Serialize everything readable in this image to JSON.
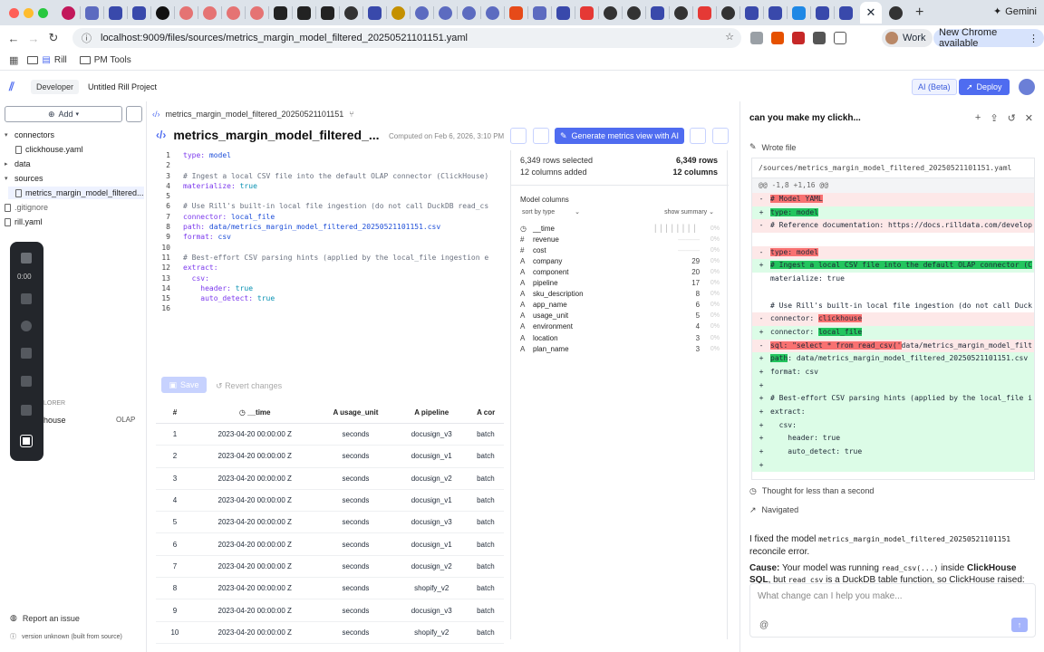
{
  "browser": {
    "url": "localhost:9009/files/sources/metrics_margin_model_filtered_20250521101151.yaml",
    "profile": "Work",
    "update_label": "New Chrome available",
    "gemini_label": "Gemini",
    "bookmarks": [
      "Rill",
      "PM Tools"
    ]
  },
  "app": {
    "logo": "Rill",
    "env_badge": "Developer",
    "project_name": "Untitled Rill Project",
    "ai_beta": "AI (Beta)",
    "deploy": "Deploy"
  },
  "sidebar": {
    "add_label": "Add",
    "tree": [
      {
        "label": "connectors",
        "kind": "folder"
      },
      {
        "label": "clickhouse.yaml",
        "kind": "file"
      },
      {
        "label": "data",
        "kind": "folder"
      },
      {
        "label": "sources",
        "kind": "folder"
      },
      {
        "label": "metrics_margin_model_filtered...",
        "kind": "file"
      },
      {
        "label": ".gitignore",
        "kind": "file"
      },
      {
        "label": "rill.yaml",
        "kind": "file"
      }
    ],
    "video_time": "0:00",
    "explorer_label": "LORER",
    "connector_name": "house",
    "connector_type": "OLAP",
    "report_issue": "Report an issue",
    "version": "version unknown (built from source)"
  },
  "editor": {
    "breadcrumb": "metrics_margin_model_filtered_20250521101151",
    "title": "metrics_margin_model_filtered_...",
    "computed": "Computed on Feb 6, 2026, 3:10 PM",
    "generate_btn": "Generate metrics view with AI",
    "save": "Save",
    "revert": "Revert changes",
    "code_lines": [
      {
        "n": "1",
        "t": "type: model"
      },
      {
        "n": "2",
        "t": ""
      },
      {
        "n": "3",
        "t": "# Ingest a local CSV file into the default OLAP connector (ClickHouse)"
      },
      {
        "n": "4",
        "t": "materialize: true"
      },
      {
        "n": "5",
        "t": ""
      },
      {
        "n": "6",
        "t": "# Use Rill's built-in local file ingestion (do not call DuckDB read_cs"
      },
      {
        "n": "7",
        "t": "connector: local_file"
      },
      {
        "n": "8",
        "t": "path: data/metrics_margin_model_filtered_20250521101151.csv"
      },
      {
        "n": "9",
        "t": "format: csv"
      },
      {
        "n": "10",
        "t": ""
      },
      {
        "n": "11",
        "t": "# Best-effort CSV parsing hints (applied by the local_file ingestion e"
      },
      {
        "n": "12",
        "t": "extract:"
      },
      {
        "n": "13",
        "t": "  csv:"
      },
      {
        "n": "14",
        "t": "    header: true"
      },
      {
        "n": "15",
        "t": "    auto_detect: true"
      },
      {
        "n": "16",
        "t": ""
      }
    ]
  },
  "table": {
    "headers": [
      "#",
      "__time",
      "usage_unit",
      "pipeline",
      "cor"
    ],
    "rows": [
      [
        "1",
        "2023-04-20 00:00:00 Z",
        "seconds",
        "docusign_v3",
        "batch"
      ],
      [
        "2",
        "2023-04-20 00:00:00 Z",
        "seconds",
        "docusign_v1",
        "batch"
      ],
      [
        "3",
        "2023-04-20 00:00:00 Z",
        "seconds",
        "docusign_v2",
        "batch"
      ],
      [
        "4",
        "2023-04-20 00:00:00 Z",
        "seconds",
        "docusign_v1",
        "batch"
      ],
      [
        "5",
        "2023-04-20 00:00:00 Z",
        "seconds",
        "docusign_v3",
        "batch"
      ],
      [
        "6",
        "2023-04-20 00:00:00 Z",
        "seconds",
        "docusign_v1",
        "batch"
      ],
      [
        "7",
        "2023-04-20 00:00:00 Z",
        "seconds",
        "docusign_v2",
        "batch"
      ],
      [
        "8",
        "2023-04-20 00:00:00 Z",
        "seconds",
        "shopify_v2",
        "batch"
      ],
      [
        "9",
        "2023-04-20 00:00:00 Z",
        "seconds",
        "docusign_v3",
        "batch"
      ],
      [
        "10",
        "2023-04-20 00:00:00 Z",
        "seconds",
        "shopify_v2",
        "batch"
      ]
    ]
  },
  "model_columns": {
    "rows_selected": "6,349 rows selected",
    "rows_total": "6,349 rows",
    "cols_added": "12 columns added",
    "cols_total": "12 columns",
    "title": "Model columns",
    "sort_by": "sort by type",
    "show_summary": "show summary",
    "columns": [
      {
        "type": "clock",
        "name": "__time",
        "count": "",
        "pct": "0%"
      },
      {
        "type": "#",
        "name": "revenue",
        "count": "",
        "pct": "0%"
      },
      {
        "type": "#",
        "name": "cost",
        "count": "",
        "pct": "0%"
      },
      {
        "type": "A",
        "name": "company",
        "count": "29",
        "pct": "0%"
      },
      {
        "type": "A",
        "name": "component",
        "count": "20",
        "pct": "0%"
      },
      {
        "type": "A",
        "name": "pipeline",
        "count": "17",
        "pct": "0%"
      },
      {
        "type": "A",
        "name": "sku_description",
        "count": "8",
        "pct": "0%"
      },
      {
        "type": "A",
        "name": "app_name",
        "count": "6",
        "pct": "0%"
      },
      {
        "type": "A",
        "name": "usage_unit",
        "count": "5",
        "pct": "0%"
      },
      {
        "type": "A",
        "name": "environment",
        "count": "4",
        "pct": "0%"
      },
      {
        "type": "A",
        "name": "location",
        "count": "3",
        "pct": "0%"
      },
      {
        "type": "A",
        "name": "plan_name",
        "count": "3",
        "pct": "0%"
      }
    ]
  },
  "chat": {
    "title": "can you make my clickh...",
    "wrote_file": "Wrote file",
    "diff_path": "/sources/metrics_margin_model_filtered_20250521101151.yaml",
    "hunk": "@@ -1,8 +1,16 @@",
    "diff": [
      {
        "s": "-",
        "k": "del",
        "pre": "",
        "hl": "# Model YAML",
        "post": ""
      },
      {
        "s": "+",
        "k": "add",
        "pre": "",
        "hl": "type: model",
        "post": ""
      },
      {
        "s": "-",
        "k": "del",
        "pre": "# Reference documentation: https://docs.rilldata.com/develop",
        "hl": "",
        "post": ""
      },
      {
        "s": "",
        "k": "ctx",
        "pre": "",
        "hl": "",
        "post": ""
      },
      {
        "s": "-",
        "k": "del",
        "pre": "",
        "hl": "type: model",
        "post": ""
      },
      {
        "s": "+",
        "k": "add",
        "pre": "",
        "hl": "# Ingest a local CSV file into the default OLAP connector (C",
        "post": ""
      },
      {
        "s": "",
        "k": "ctx",
        "pre": "materialize: true",
        "hl": "",
        "post": ""
      },
      {
        "s": "",
        "k": "ctx",
        "pre": "",
        "hl": "",
        "post": ""
      },
      {
        "s": "",
        "k": "ctx",
        "pre": "# Use Rill's built-in local file ingestion (do not call Duck",
        "hl": "",
        "post": ""
      },
      {
        "s": "-",
        "k": "del",
        "pre": "connector: ",
        "hl": "clickhouse",
        "post": ""
      },
      {
        "s": "+",
        "k": "add",
        "pre": "connector: ",
        "hl": "local_file",
        "post": ""
      },
      {
        "s": "-",
        "k": "del",
        "pre": "",
        "hl": "sql: \"select * from read_csv('",
        "post": "data/metrics_margin_model_filt"
      },
      {
        "s": "+",
        "k": "add",
        "pre": "",
        "hl": "path",
        "post": ": data/metrics_margin_model_filtered_20250521101151.csv"
      },
      {
        "s": "+",
        "k": "add",
        "pre": "format: csv",
        "hl": "",
        "post": ""
      },
      {
        "s": "+",
        "k": "add",
        "pre": "",
        "hl": "",
        "post": ""
      },
      {
        "s": "+",
        "k": "add",
        "pre": "# Best-effort CSV parsing hints (applied by the local_file i",
        "hl": "",
        "post": ""
      },
      {
        "s": "+",
        "k": "add",
        "pre": "extract:",
        "hl": "",
        "post": ""
      },
      {
        "s": "+",
        "k": "add",
        "pre": "  csv:",
        "hl": "",
        "post": ""
      },
      {
        "s": "+",
        "k": "add",
        "pre": "    header: true",
        "hl": "",
        "post": ""
      },
      {
        "s": "+",
        "k": "add",
        "pre": "    auto_detect: true",
        "hl": "",
        "post": ""
      },
      {
        "s": "+",
        "k": "add",
        "pre": "",
        "hl": "",
        "post": ""
      }
    ],
    "thought": "Thought for less than a second",
    "navigated": "Navigated",
    "msg1_a": "I fixed the model",
    "msg1_code": "metrics_margin_model_filtered_20250521101151",
    "msg1_b": "reconcile error.",
    "msg2_cause": "Cause:",
    "msg2_a": "Your model was running",
    "msg2_code1": "read_csv(...)",
    "msg2_b": "inside",
    "msg2_ch": "ClickHouse SQL",
    "msg2_c": ", but",
    "msg2_code2": "read_csv",
    "msg2_d": "is a DuckDB table function, so ClickHouse raised:",
    "input_placeholder": "What change can I help you make...",
    "input_at": "@"
  },
  "colors": {
    "accent": "#4f6cf0",
    "diff_add": "#dcfce7",
    "diff_del": "#fde8e8"
  }
}
